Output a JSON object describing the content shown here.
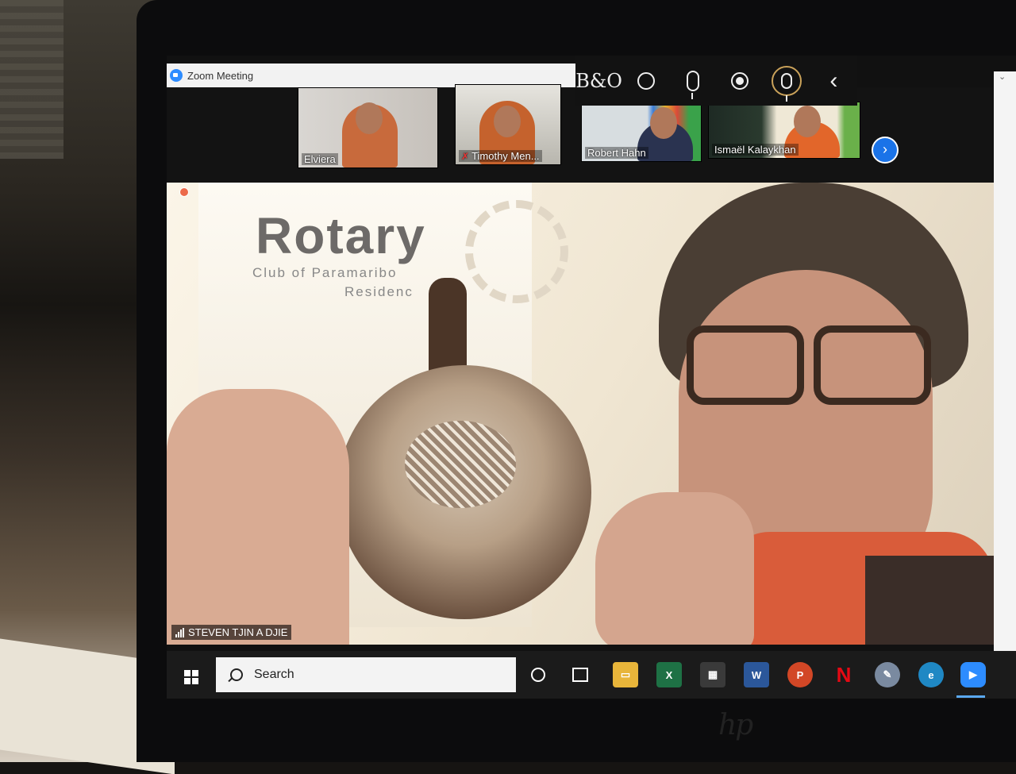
{
  "window": {
    "title": "Zoom Meeting"
  },
  "gallery": {
    "participants": [
      {
        "name": "Elviera"
      },
      {
        "name": "Timothy Men..."
      },
      {
        "name": "Robert Hahn"
      },
      {
        "name": "Ismaël Kalaykhan"
      }
    ]
  },
  "controls": {
    "bo_label": "B&O"
  },
  "speaker": {
    "name": "STEVEN TJIN A DJIE",
    "backdrop": {
      "line1": "Rotary",
      "line2": "Club of Paramaribo",
      "line3": "Residenc"
    }
  },
  "taskbar": {
    "search_label": "Search",
    "apps": [
      "file-explorer",
      "excel",
      "store",
      "word",
      "powerpoint",
      "netflix",
      "paint",
      "edge",
      "zoom"
    ]
  },
  "colors": {
    "zoom_blue": "#2d8cff",
    "accent": "#1a73e8",
    "shirt": "#d95c3a"
  }
}
